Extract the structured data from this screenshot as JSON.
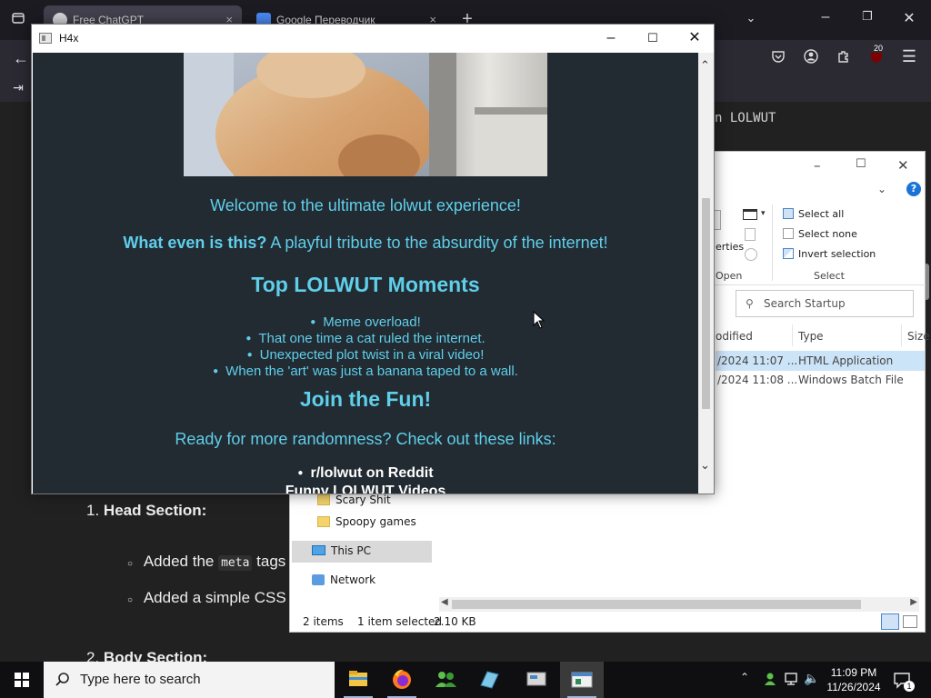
{
  "browser": {
    "tabs": [
      {
        "title": "Free ChatGPT",
        "close": "×"
      },
      {
        "title": "Google Переводчик",
        "close": "×"
      }
    ],
    "new_tab": "+",
    "badge": "20"
  },
  "chat": {
    "code_snippet": "n LOLWUT",
    "list": [
      {
        "number": "1.",
        "label": "Head Section:"
      },
      {
        "number": "2.",
        "label": "Body Section:"
      }
    ],
    "sub_items": [
      {
        "pre": "Added the",
        "code": "meta",
        "post": "tags"
      },
      {
        "pre": "Added a simple CSS",
        "code": "",
        "post": ""
      }
    ]
  },
  "explorer": {
    "ribbon": {
      "properties_partial": "erties",
      "open_label": "Open",
      "select_all": "Select all",
      "select_none": "Select none",
      "invert_selection": "Invert selection",
      "select_group": "Select"
    },
    "search_placeholder": "Search Startup",
    "columns": {
      "modified": "odified",
      "type": "Type",
      "size": "Size"
    },
    "files": [
      {
        "modified": "/2024 11:07 ...",
        "type": "HTML Application",
        "selected": true
      },
      {
        "modified": "/2024 11:08 ...",
        "type": "Windows Batch File",
        "selected": false
      }
    ],
    "nav": [
      {
        "label": "Scary Shit",
        "icon": "folder-icon"
      },
      {
        "label": "Spoopy games",
        "icon": "folder-icon"
      },
      {
        "label": "This PC",
        "icon": "computer-icon"
      },
      {
        "label": "Network",
        "icon": "network-icon"
      }
    ],
    "status": {
      "items": "2 items",
      "selected": "1 item selected",
      "size": "2.10 KB"
    }
  },
  "h4x": {
    "title": "H4x",
    "welcome": "Welcome to the ultimate lolwut experience!",
    "what_bold": "What even is this?",
    "what_rest": "A playful tribute to the absurdity of the internet!",
    "top_heading": "Top LOLWUT Moments",
    "moments": [
      "Meme overload!",
      "That one time a cat ruled the internet.",
      "Unexpected plot twist in a viral video!",
      "When the 'art' was just a banana taped to a wall."
    ],
    "join_heading": "Join the Fun!",
    "ready_text": "Ready for more randomness? Check out these links:",
    "links": [
      "r/lolwut on Reddit",
      "Funny LOLWUT Videos"
    ]
  },
  "taskbar": {
    "search_placeholder": "Type here to search",
    "time": "11:09 PM",
    "date": "11/26/2024",
    "notification_badge": "1"
  },
  "colors": {
    "hta_background": "#222a32",
    "hta_accent": "#5fcfe9",
    "hta_link": "#ffffff",
    "selection": "#cce4f7"
  }
}
